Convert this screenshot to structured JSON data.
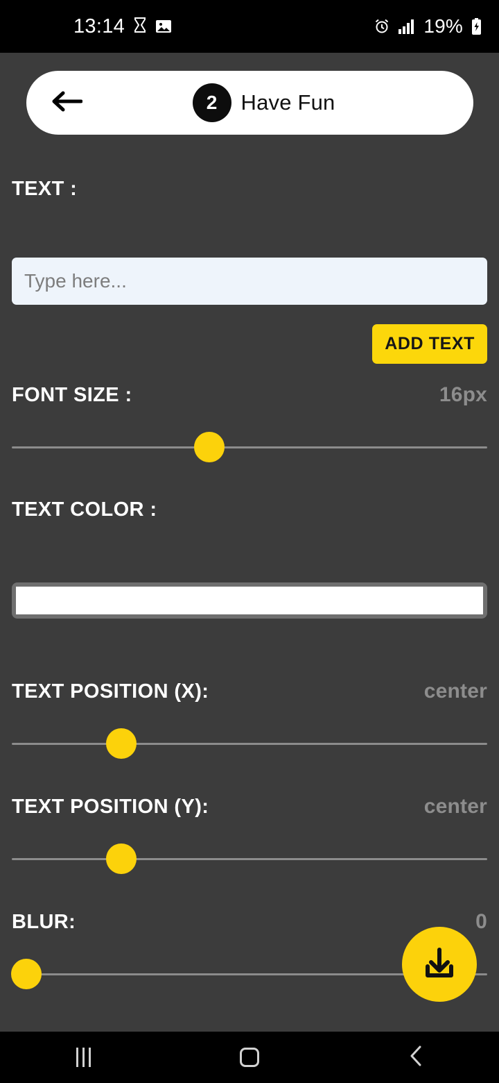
{
  "status_bar": {
    "time": "13:14",
    "left_icons": [
      "hourglass-icon",
      "image-icon"
    ],
    "right_icons": [
      "alarm-icon",
      "signal-bars-icon"
    ],
    "battery_percent": "19%",
    "battery_state": "charging"
  },
  "header": {
    "back_icon": "back-arrow-icon",
    "step_number": "2",
    "title": "Have Fun"
  },
  "form": {
    "text_label": "TEXT :",
    "text_input_value": "",
    "text_input_placeholder": "Type here...",
    "add_text_label": "ADD TEXT",
    "font_size_label": "FONT SIZE :",
    "font_size_value": "16px",
    "font_size_thumb_percent": 41.5,
    "text_color_label": "TEXT COLOR :",
    "text_color_value": "#ffffff",
    "position_x_label": "TEXT POSITION (X):",
    "position_x_value": "center",
    "position_x_thumb_percent": 23,
    "position_y_label": "TEXT POSITION (Y):",
    "position_y_value": "center",
    "position_y_thumb_percent": 23,
    "blur_label": "BLUR:",
    "blur_value": "0",
    "blur_thumb_percent": 3
  },
  "fab": {
    "icon": "download-icon"
  },
  "nav_bar": {
    "recents_label": "recents-icon",
    "home_label": "home-icon",
    "back_label": "back-icon"
  },
  "colors": {
    "accent": "#fcd20b",
    "background": "#3c3c3c",
    "input_bg": "#eef4fb",
    "value_text": "#8d8d8d"
  }
}
